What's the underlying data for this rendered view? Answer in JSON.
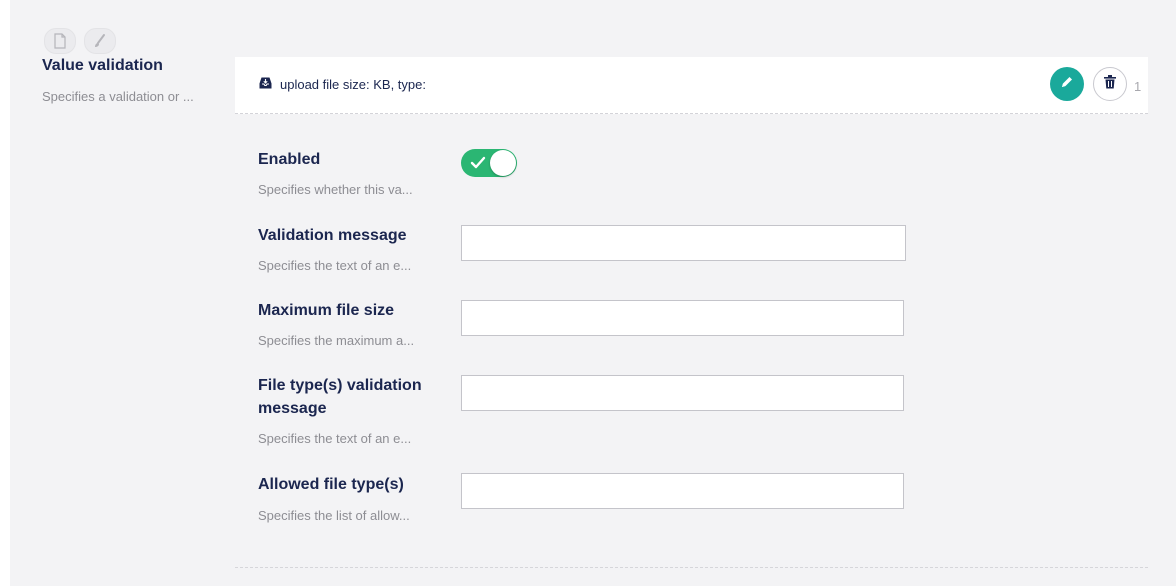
{
  "property": {
    "title": "Value validation",
    "description": "Specifies a validation or ..."
  },
  "toolbar_icons": [
    "document-icon",
    "brush-icon"
  ],
  "block": {
    "icon": "upload-tray-icon",
    "label": "upload file size: KB, type:",
    "edit_icon": "pencil-icon",
    "delete_icon": "trash-icon",
    "count": "1"
  },
  "fields": {
    "enabled": {
      "label": "Enabled",
      "description": "Specifies whether this va...",
      "value": true
    },
    "validation_message": {
      "label": "Validation message",
      "description": "Specifies the text of an e...",
      "value": ""
    },
    "max_file_size": {
      "label": "Maximum file size",
      "description": "Specifies the maximum a...",
      "value": ""
    },
    "file_type_message": {
      "label": "File type(s) validation message",
      "description": "Specifies the text of an e...",
      "value": ""
    },
    "allowed_file_types": {
      "label": "Allowed file type(s)",
      "description": "Specifies the list of allow...",
      "value": ""
    }
  },
  "colors": {
    "accent": "#1aa99b",
    "toggle_on": "#2bb673",
    "text": "#1b264f",
    "muted": "#8d8d93",
    "panel_bg": "#f3f3f5"
  }
}
